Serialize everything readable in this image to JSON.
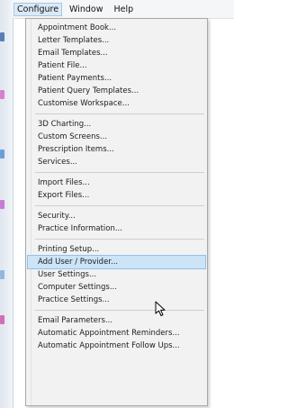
{
  "menubar": {
    "items": [
      {
        "label": "Configure",
        "open": true
      },
      {
        "label": "Window",
        "open": false
      },
      {
        "label": "Help",
        "open": false
      }
    ]
  },
  "menu": {
    "groups": [
      [
        "Appointment Book...",
        "Letter Templates...",
        "Email Templates...",
        "Patient File...",
        "Patient Payments...",
        "Patient Query Templates...",
        "Customise Workspace..."
      ],
      [
        "3D Charting...",
        "Custom Screens...",
        "Prescription Items...",
        "Services..."
      ],
      [
        "Import Files...",
        "Export Files..."
      ],
      [
        "Security...",
        "Practice Information..."
      ],
      [
        "Printing Setup...",
        "Add User / Provider...",
        "User Settings...",
        "Computer Settings...",
        "Practice Settings..."
      ],
      [
        "Email Parameters...",
        "Automatic Appointment Reminders...",
        "Automatic Appointment Follow Ups..."
      ]
    ],
    "highlighted": "Add User / Provider..."
  },
  "colors": {
    "menu_bg": "#f2f2f2",
    "highlight_bg": "#cce4f7",
    "highlight_border": "#94c0e8"
  },
  "icons": {
    "cursor": "mouse-pointer-icon"
  }
}
